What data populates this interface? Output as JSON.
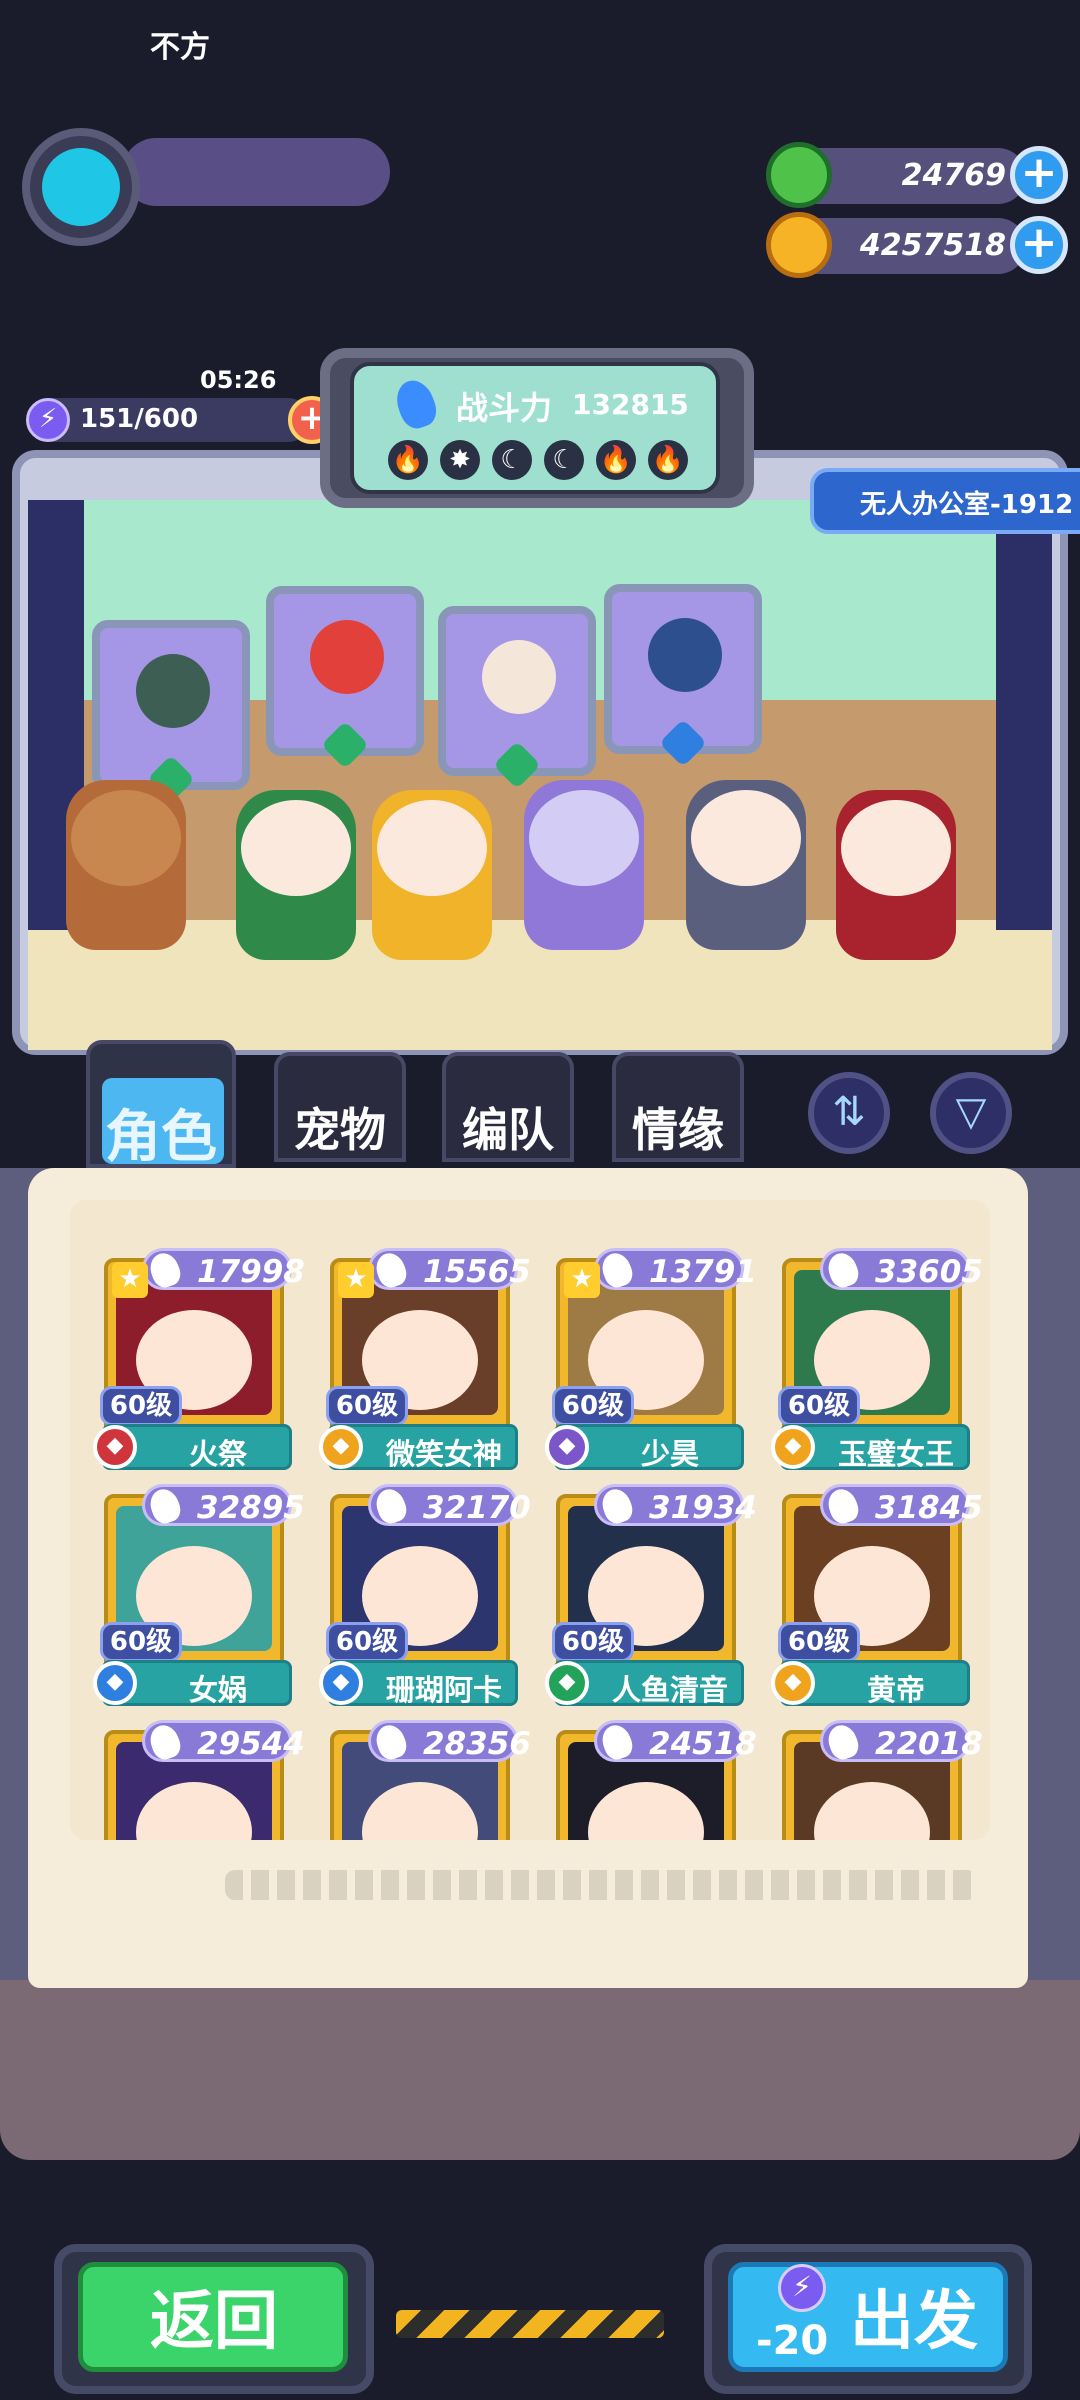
{
  "player": {
    "name": "不方"
  },
  "resources": {
    "green_currency": "24769",
    "gold_currency": "4257518"
  },
  "energy": {
    "text": "151/600",
    "timer": "05:26"
  },
  "battle_power": {
    "label": "战斗力",
    "value": "132815"
  },
  "elements": [
    "🔥",
    "✸",
    "☾",
    "☾",
    "🔥",
    "🔥"
  ],
  "location": "无人办公室-1912",
  "tabs": [
    {
      "label": "角色",
      "active": true
    },
    {
      "label": "宠物"
    },
    {
      "label": "编队"
    },
    {
      "label": "情缘"
    }
  ],
  "cards": [
    {
      "power": "17998",
      "level": "60级",
      "name": "火祭",
      "star": true,
      "gem": "#d0353b",
      "art": "#8d1d2a"
    },
    {
      "power": "15565",
      "level": "60级",
      "name": "微笑女神",
      "star": true,
      "gem": "#f0a41e",
      "art": "#6a3f2a"
    },
    {
      "power": "13791",
      "level": "60级",
      "name": "少昊",
      "star": true,
      "gem": "#7b56c9",
      "art": "#9e7a44"
    },
    {
      "power": "33605",
      "level": "60级",
      "name": "玉璧女王",
      "star": false,
      "gem": "#f0a41e",
      "art": "#2f7a4d"
    },
    {
      "power": "32895",
      "level": "60级",
      "name": "女娲",
      "star": false,
      "gem": "#2f7fe0",
      "art": "#3fa39a"
    },
    {
      "power": "32170",
      "level": "60级",
      "name": "珊瑚阿卡",
      "star": false,
      "gem": "#2f7fe0",
      "art": "#2d356e"
    },
    {
      "power": "31934",
      "level": "60级",
      "name": "人鱼清音",
      "star": false,
      "gem": "#23a35a",
      "art": "#23304c"
    },
    {
      "power": "31845",
      "level": "60级",
      "name": "黄帝",
      "star": false,
      "gem": "#f0a41e",
      "art": "#6b3f22"
    },
    {
      "power": "29544",
      "level": "",
      "name": "",
      "star": false,
      "gem": "",
      "art": "#3b2a6e"
    },
    {
      "power": "28356",
      "level": "",
      "name": "",
      "star": false,
      "gem": "",
      "art": "#434b7a"
    },
    {
      "power": "24518",
      "level": "",
      "name": "",
      "star": false,
      "gem": "",
      "art": "#1d1d2a"
    },
    {
      "power": "22018",
      "level": "",
      "name": "",
      "star": false,
      "gem": "",
      "art": "#5a3a24"
    }
  ],
  "buttons": {
    "back": "返回",
    "go": "出发",
    "go_cost": "-20"
  }
}
